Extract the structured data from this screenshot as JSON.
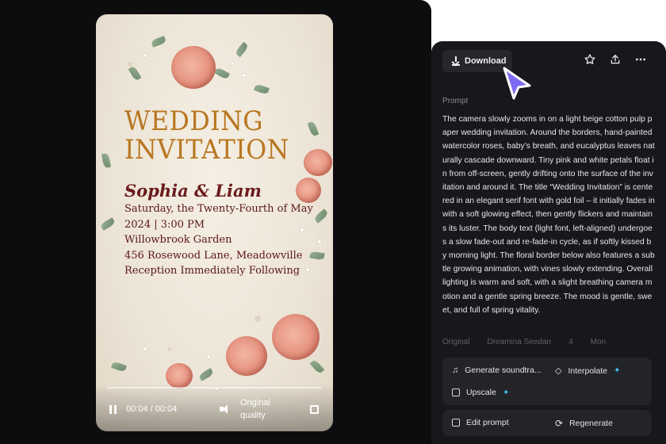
{
  "video": {
    "invitation_title_line1": "WEDDING",
    "invitation_title_line2": "INVITATION",
    "names": "Sophia & Liam",
    "body_lines": [
      "Saturday, the Twenty-Fourth of May",
      "2024 | 3:00 PM",
      "Willowbrook Garden",
      "456 Rosewood Lane, Meadowville",
      "Reception Immediately Following"
    ],
    "time": "00:04 / 00:04",
    "quality": "Original quality",
    "controls_icons": [
      "pause-icon",
      "volume-icon",
      "fullscreen-icon"
    ]
  },
  "toolbar": {
    "download_label": "Download",
    "icons": [
      "star-icon",
      "share-icon",
      "more-icon"
    ]
  },
  "prompt": {
    "label": "Prompt",
    "text": "The camera slowly zooms in on a light beige cotton pulp paper wedding invitation. Around the borders, hand-painted watercolor roses, baby’s breath, and eucalyptus leaves naturally cascade downward. Tiny pink and white petals float in from off-screen, gently drifting onto the surface of the invitation and around it. The title “Wedding Invitation” is centered in an elegant serif font with gold foil – it initially fades in with a soft glowing effect, then gently flickers and maintains its luster. The body text (light font, left-aligned) undergoes a slow fade-out and re-fade-in cycle, as if softly kissed by morning light. The floral border below also features a subtle growing animation, with vines slowly extending. Overall lighting is warm and soft, with a slight breathing camera motion and a gentle spring breeze. The mood is gentle, sweet, and full of spring vitality."
  },
  "meta": {
    "items": [
      "Original",
      "Dreamina Seedan",
      "4",
      "Mon"
    ]
  },
  "actions": {
    "generate_soundtrack": "Generate soundtra...",
    "interpolate": "Interpolate",
    "upscale": "Upscale",
    "edit_prompt": "Edit prompt",
    "regenerate": "Regenerate",
    "spark_icon": "✦"
  },
  "colors": {
    "accent_cursor": "#7d6cf2",
    "spark": "#3fc1ff",
    "title_gold": "#b8761f",
    "names_burgundy": "#6a1b1b"
  }
}
